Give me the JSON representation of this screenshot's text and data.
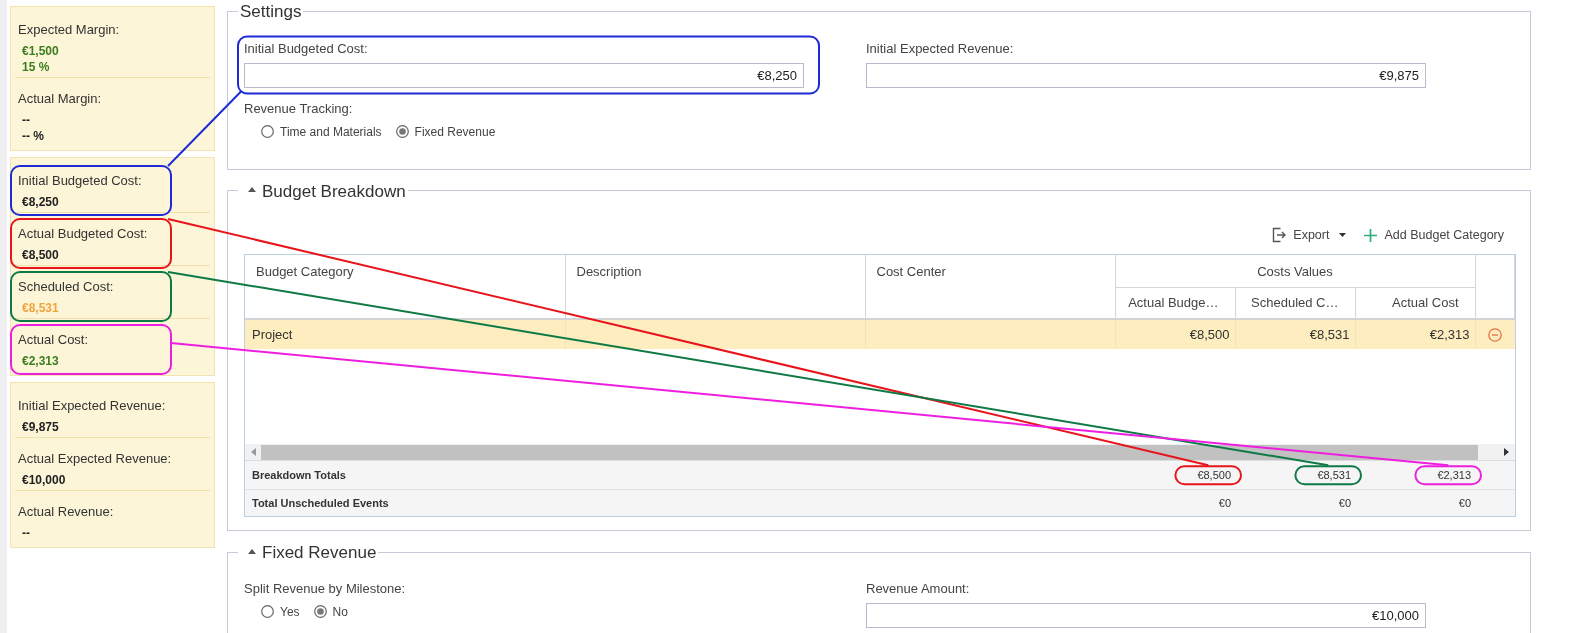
{
  "summary": {
    "cards": [
      {
        "items": [
          {
            "label": "Expected Margin:",
            "values": [
              {
                "text": "€1,500",
                "color": "#3b7d1f"
              },
              {
                "text": "15 %",
                "color": "#3b7d1f"
              }
            ]
          },
          {
            "label": "Actual Margin:",
            "values": [
              {
                "text": "--",
                "color": "#222222"
              },
              {
                "text": "-- %",
                "color": "#222222"
              }
            ]
          }
        ]
      },
      {
        "items": [
          {
            "label": "Initial Budgeted Cost:",
            "values": [
              {
                "text": "€8,250",
                "color": "#222222"
              }
            ],
            "color": "#1d2bd6"
          },
          {
            "label": "Actual Budgeted Cost:",
            "values": [
              {
                "text": "€8,500",
                "color": "#222222"
              }
            ],
            "color": "#e8141b"
          },
          {
            "label": "Scheduled Cost:",
            "values": [
              {
                "text": "€8,531",
                "color": "#f2a43c"
              }
            ],
            "color": "#0d7a45"
          },
          {
            "label": "Actual Cost:",
            "values": [
              {
                "text": "€2,313",
                "color": "#3b7d1f"
              }
            ],
            "color": "#ee1ee0"
          }
        ]
      },
      {
        "items": [
          {
            "label": "Initial Expected Revenue:",
            "values": [
              {
                "text": "€9,875",
                "color": "#222222"
              }
            ]
          },
          {
            "label": "Actual Expected Revenue:",
            "values": [
              {
                "text": "€10,000",
                "color": "#222222"
              }
            ]
          },
          {
            "label": "Actual Revenue:",
            "values": [
              {
                "text": "--",
                "color": "#222222"
              }
            ]
          }
        ]
      }
    ]
  },
  "settings": {
    "title": "Settings",
    "fields": [
      {
        "label": "Initial Budgeted Cost:",
        "value": "€8,250",
        "color": "#1d2bd6"
      },
      {
        "label": "Initial Expected Revenue:",
        "value": "€9,875"
      }
    ],
    "revenue_tracking": {
      "label": "Revenue Tracking:",
      "options": [
        {
          "label": "Time and Materials",
          "selected": false
        },
        {
          "label": "Fixed Revenue",
          "selected": true
        }
      ]
    }
  },
  "budget_breakdown": {
    "title": "Budget Breakdown",
    "expanded": true,
    "toolbar": [
      {
        "kind": "export",
        "label": "Export"
      },
      {
        "kind": "add",
        "label": "Add Budget Category"
      }
    ],
    "table": {
      "columns": [
        {
          "label": "Budget Category"
        },
        {
          "label": "Description"
        },
        {
          "label": "Cost Center"
        }
      ],
      "column_group": {
        "label": "Costs Values",
        "columns": [
          {
            "label": "Actual Budge…"
          },
          {
            "label": "Scheduled C…"
          },
          {
            "label": "Actual Cost"
          }
        ]
      },
      "rows": [
        {
          "label": "Project",
          "values": [
            "€8,500",
            "€8,531",
            "€2,313"
          ],
          "selected": true,
          "removable": true
        }
      ],
      "totals": [
        {
          "label": "Breakdown Totals",
          "values": [
            {
              "text": "€8,500",
              "color": "#e8141b"
            },
            {
              "text": "€8,531",
              "color": "#0d7a45"
            },
            {
              "text": "€2,313",
              "color": "#ee1ee0"
            }
          ]
        },
        {
          "label": "Total Unscheduled Events",
          "values": [
            {
              "text": "€0"
            },
            {
              "text": "€0"
            },
            {
              "text": "€0"
            }
          ]
        }
      ]
    }
  },
  "fixed_revenue": {
    "title": "Fixed Revenue",
    "expanded": true,
    "split": {
      "label": "Split Revenue by Milestone:",
      "options": [
        {
          "label": "Yes",
          "selected": false
        },
        {
          "label": "No",
          "selected": true
        }
      ]
    },
    "amount": {
      "label": "Revenue Amount:",
      "value": "€10,000"
    }
  }
}
